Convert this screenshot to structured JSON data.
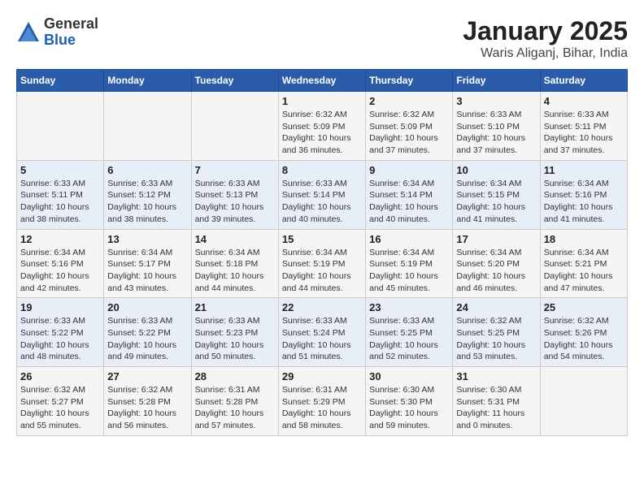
{
  "header": {
    "logo": {
      "general": "General",
      "blue": "Blue"
    },
    "title": "January 2025",
    "location": "Waris Aliganj, Bihar, India"
  },
  "calendar": {
    "days_of_week": [
      "Sunday",
      "Monday",
      "Tuesday",
      "Wednesday",
      "Thursday",
      "Friday",
      "Saturday"
    ],
    "weeks": [
      [
        {
          "day": "",
          "info": ""
        },
        {
          "day": "",
          "info": ""
        },
        {
          "day": "",
          "info": ""
        },
        {
          "day": "1",
          "info": "Sunrise: 6:32 AM\nSunset: 5:09 PM\nDaylight: 10 hours and 36 minutes."
        },
        {
          "day": "2",
          "info": "Sunrise: 6:32 AM\nSunset: 5:09 PM\nDaylight: 10 hours and 37 minutes."
        },
        {
          "day": "3",
          "info": "Sunrise: 6:33 AM\nSunset: 5:10 PM\nDaylight: 10 hours and 37 minutes."
        },
        {
          "day": "4",
          "info": "Sunrise: 6:33 AM\nSunset: 5:11 PM\nDaylight: 10 hours and 37 minutes."
        }
      ],
      [
        {
          "day": "5",
          "info": "Sunrise: 6:33 AM\nSunset: 5:11 PM\nDaylight: 10 hours and 38 minutes."
        },
        {
          "day": "6",
          "info": "Sunrise: 6:33 AM\nSunset: 5:12 PM\nDaylight: 10 hours and 38 minutes."
        },
        {
          "day": "7",
          "info": "Sunrise: 6:33 AM\nSunset: 5:13 PM\nDaylight: 10 hours and 39 minutes."
        },
        {
          "day": "8",
          "info": "Sunrise: 6:33 AM\nSunset: 5:14 PM\nDaylight: 10 hours and 40 minutes."
        },
        {
          "day": "9",
          "info": "Sunrise: 6:34 AM\nSunset: 5:14 PM\nDaylight: 10 hours and 40 minutes."
        },
        {
          "day": "10",
          "info": "Sunrise: 6:34 AM\nSunset: 5:15 PM\nDaylight: 10 hours and 41 minutes."
        },
        {
          "day": "11",
          "info": "Sunrise: 6:34 AM\nSunset: 5:16 PM\nDaylight: 10 hours and 41 minutes."
        }
      ],
      [
        {
          "day": "12",
          "info": "Sunrise: 6:34 AM\nSunset: 5:16 PM\nDaylight: 10 hours and 42 minutes."
        },
        {
          "day": "13",
          "info": "Sunrise: 6:34 AM\nSunset: 5:17 PM\nDaylight: 10 hours and 43 minutes."
        },
        {
          "day": "14",
          "info": "Sunrise: 6:34 AM\nSunset: 5:18 PM\nDaylight: 10 hours and 44 minutes."
        },
        {
          "day": "15",
          "info": "Sunrise: 6:34 AM\nSunset: 5:19 PM\nDaylight: 10 hours and 44 minutes."
        },
        {
          "day": "16",
          "info": "Sunrise: 6:34 AM\nSunset: 5:19 PM\nDaylight: 10 hours and 45 minutes."
        },
        {
          "day": "17",
          "info": "Sunrise: 6:34 AM\nSunset: 5:20 PM\nDaylight: 10 hours and 46 minutes."
        },
        {
          "day": "18",
          "info": "Sunrise: 6:34 AM\nSunset: 5:21 PM\nDaylight: 10 hours and 47 minutes."
        }
      ],
      [
        {
          "day": "19",
          "info": "Sunrise: 6:33 AM\nSunset: 5:22 PM\nDaylight: 10 hours and 48 minutes."
        },
        {
          "day": "20",
          "info": "Sunrise: 6:33 AM\nSunset: 5:22 PM\nDaylight: 10 hours and 49 minutes."
        },
        {
          "day": "21",
          "info": "Sunrise: 6:33 AM\nSunset: 5:23 PM\nDaylight: 10 hours and 50 minutes."
        },
        {
          "day": "22",
          "info": "Sunrise: 6:33 AM\nSunset: 5:24 PM\nDaylight: 10 hours and 51 minutes."
        },
        {
          "day": "23",
          "info": "Sunrise: 6:33 AM\nSunset: 5:25 PM\nDaylight: 10 hours and 52 minutes."
        },
        {
          "day": "24",
          "info": "Sunrise: 6:32 AM\nSunset: 5:25 PM\nDaylight: 10 hours and 53 minutes."
        },
        {
          "day": "25",
          "info": "Sunrise: 6:32 AM\nSunset: 5:26 PM\nDaylight: 10 hours and 54 minutes."
        }
      ],
      [
        {
          "day": "26",
          "info": "Sunrise: 6:32 AM\nSunset: 5:27 PM\nDaylight: 10 hours and 55 minutes."
        },
        {
          "day": "27",
          "info": "Sunrise: 6:32 AM\nSunset: 5:28 PM\nDaylight: 10 hours and 56 minutes."
        },
        {
          "day": "28",
          "info": "Sunrise: 6:31 AM\nSunset: 5:28 PM\nDaylight: 10 hours and 57 minutes."
        },
        {
          "day": "29",
          "info": "Sunrise: 6:31 AM\nSunset: 5:29 PM\nDaylight: 10 hours and 58 minutes."
        },
        {
          "day": "30",
          "info": "Sunrise: 6:30 AM\nSunset: 5:30 PM\nDaylight: 10 hours and 59 minutes."
        },
        {
          "day": "31",
          "info": "Sunrise: 6:30 AM\nSunset: 5:31 PM\nDaylight: 11 hours and 0 minutes."
        },
        {
          "day": "",
          "info": ""
        }
      ]
    ]
  }
}
